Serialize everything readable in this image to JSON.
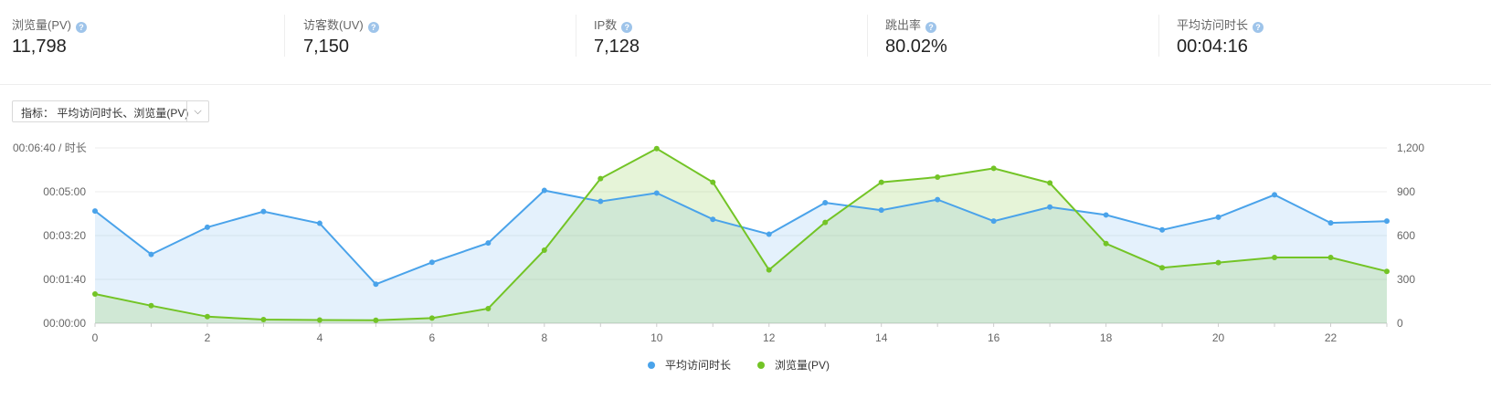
{
  "stats": [
    {
      "label": "浏览量(PV)",
      "value": "11,798"
    },
    {
      "label": "访客数(UV)",
      "value": "7,150"
    },
    {
      "label": "IP数",
      "value": "7,128"
    },
    {
      "label": "跳出率",
      "value": "80.02%"
    },
    {
      "label": "平均访问时长",
      "value": "00:04:16"
    }
  ],
  "help_icon_glyph": "?",
  "metric_selector": {
    "label": "指标：  平均访问时长、浏览量(PV)",
    "chevron_glyph": "⌵"
  },
  "chart_data": {
    "type": "area",
    "x": [
      0,
      1,
      2,
      3,
      4,
      5,
      6,
      7,
      8,
      9,
      10,
      11,
      12,
      13,
      14,
      15,
      16,
      17,
      18,
      19,
      20,
      21,
      22,
      23
    ],
    "x_ticks": [
      "0",
      "2",
      "4",
      "6",
      "8",
      "10",
      "12",
      "14",
      "16",
      "18",
      "20",
      "22"
    ],
    "y_left_label": "00:06:40 / 时长",
    "y_left_ticks": [
      "00:00:00",
      "00:01:40",
      "00:03:20",
      "00:05:00"
    ],
    "y_left_range_seconds": [
      0,
      400
    ],
    "y_right_ticks": [
      "0",
      "300",
      "600",
      "900",
      "1,200"
    ],
    "y_right_range": [
      0,
      1200
    ],
    "grid": true,
    "legend_position": "bottom-center",
    "series": [
      {
        "name": "平均访问时长",
        "axis": "left",
        "color": "#4aa3ea",
        "values_seconds": [
          256,
          157,
          219,
          255,
          228,
          89,
          139,
          183,
          303,
          278,
          297,
          237,
          203,
          275,
          258,
          282,
          233,
          265,
          247,
          213,
          242,
          293,
          229,
          233
        ]
      },
      {
        "name": "浏览量(PV)",
        "axis": "right",
        "color": "#73c426",
        "values": [
          200,
          120,
          45,
          25,
          22,
          20,
          35,
          100,
          500,
          990,
          1195,
          965,
          365,
          690,
          965,
          1000,
          1060,
          960,
          545,
          380,
          415,
          450,
          450,
          355
        ]
      }
    ]
  }
}
